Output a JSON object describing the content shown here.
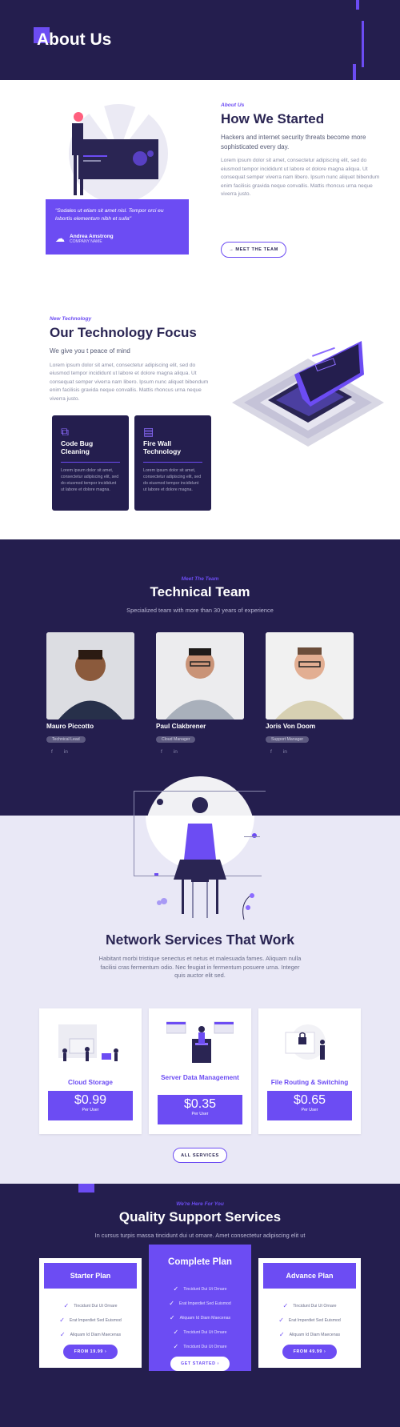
{
  "header": {
    "title": "About Us"
  },
  "how": {
    "eyebrow": "About Us",
    "title": "How We Started",
    "lead": "Hackers and internet security threats become more sophisticated every day.",
    "body": "Lorem ipsum dolor sit amet, consectetur adipiscing elit, sed do eiusmod tempor incididunt ut labore et dolore magna aliqua. Ut consequat semper viverra nam libero. Ipsum nunc aliquet bibendum enim facilisis gravida neque convallis. Mattis rhoncus urna neque viverra justo.",
    "quote": "\"Sodales ut etiam sit amet nisl. Tempor orci eu lobortis elementum nibh et sulla\"",
    "author_name": "Andrea Amstrong",
    "author_role": "COMPANY NAME",
    "button": "→ MEET THE TEAM"
  },
  "tech": {
    "eyebrow": "New Technology",
    "title": "Our Technology Focus",
    "lead": "We give you t peace of mind",
    "body": "Lorem ipsum dolor sit amet, consectetur adipiscing elit, sed do eiusmod tempor incididunt ut labore et dolore magna aliqua. Ut consequat semper viverra nam libero. Ipsum nunc aliquet bibendum enim facilisis gravida neque convallis. Mattis rhoncus urna neque viverra justo.",
    "cards": [
      {
        "title": "Code Bug Cleaning",
        "text": "Lorem ipsum dolor sit amet, consectetur adipiscing elit, sed do eiusmod tempor incididunt ut labore et dolore magna."
      },
      {
        "title": "Fire Wall Technology",
        "text": "Lorem ipsum dolor sit amet, consectetur adipiscing elit, sed do eiusmod tempor incididunt ut labore et dolore magna."
      }
    ]
  },
  "team": {
    "eyebrow": "Meet The Team",
    "title": "Technical Team",
    "subtitle": "Specialized team with more than 30 years of experience",
    "members": [
      {
        "name": "Mauro Piccotto",
        "role": "Technical Lead",
        "social": [
          "f",
          "in"
        ]
      },
      {
        "name": "Paul Clakbrener",
        "role": "Cloud Manager",
        "social": [
          "f",
          "in"
        ]
      },
      {
        "name": "Joris Von Doom",
        "role": "Support Manager",
        "social": [
          "f",
          "in"
        ]
      }
    ]
  },
  "network": {
    "title": "Network Services That Work",
    "subtitle": "Habitant morbi tristique senectus et netus et malesuada fames. Aliquam nulla facilisi cras fermentum odio. Nec feugiat in fermentum posuere urna. Integer quis auctor elit sed.",
    "cards": [
      {
        "title": "Cloud Storage",
        "price": "$0.99",
        "unit": "Per User"
      },
      {
        "title": "Server Data Management",
        "price": "$0.35",
        "unit": "Per User"
      },
      {
        "title": "File Routing & Switching",
        "price": "$0.65",
        "unit": "Per User"
      }
    ],
    "button": "ALL SERVICES"
  },
  "support": {
    "eyebrow": "We're Here For You",
    "title": "Quality Support Services",
    "subtitle": "In cursus turpis massa tincidunt dui ut ornare. Amet consectetur adipiscing elit ut",
    "plans": [
      {
        "name": "Starter Plan",
        "features": [
          "Tincidunt Dui Ut Ornare",
          "Erat Imperdiet Sed Euismod",
          "Aliquam Id Diam Maecenas"
        ],
        "button": "FROM 19.99  ›"
      },
      {
        "name": "Complete Plan",
        "features": [
          "Tincidunt Dui Ut Ornare",
          "Erat Imperdiet Sed Euismod",
          "Aliquam Id Diam Maecenas",
          "Tincidunt Dui Ut Ornare",
          "Tincidunt Dui Ut Ornare"
        ],
        "button": "GET STARTED  ›"
      },
      {
        "name": "Advance Plan",
        "features": [
          "Tincidunt Dui Ut Ornare",
          "Erat Imperdiet Sed Euismod",
          "Aliquam Id Diam Maecenas"
        ],
        "button": "FROM 49.99  ›"
      }
    ]
  },
  "colors": {
    "accent": "#6c4cf3",
    "dark": "#241e4e",
    "light_bg": "#e9e8f6"
  }
}
